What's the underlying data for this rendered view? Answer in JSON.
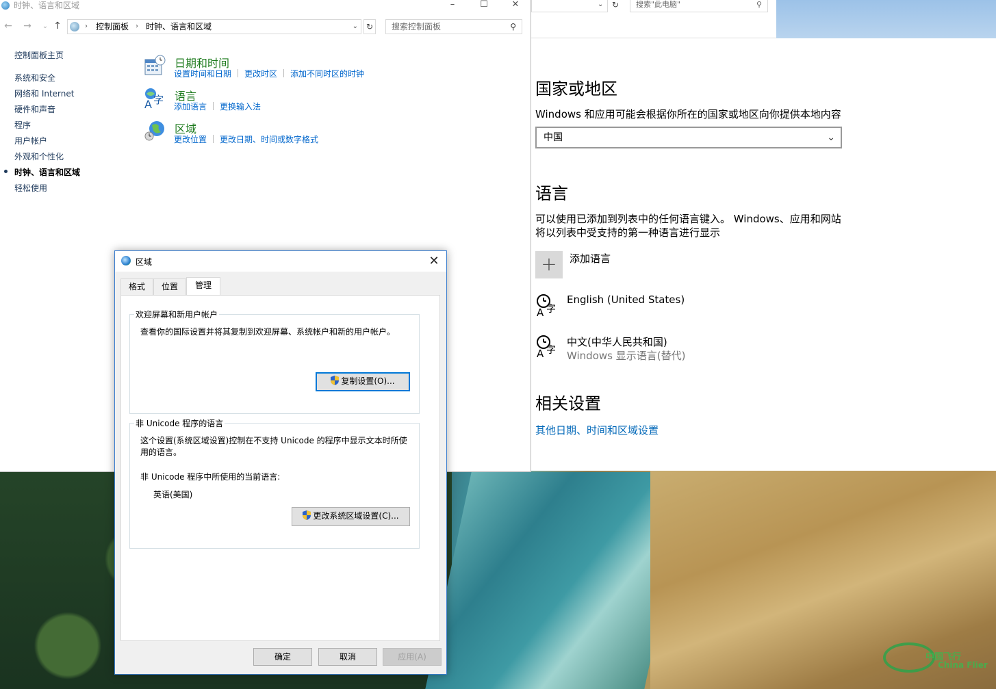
{
  "control_panel": {
    "window_title": "时钟、语言和区域",
    "address_crumbs": [
      "控制面板",
      "时钟、语言和区域"
    ],
    "search_placeholder": "搜索控制面板",
    "sidenav": [
      {
        "label": "控制面板主页",
        "active": false
      },
      {
        "label": "系统和安全",
        "active": false
      },
      {
        "label": "网络和 Internet",
        "active": false
      },
      {
        "label": "硬件和声音",
        "active": false
      },
      {
        "label": "程序",
        "active": false
      },
      {
        "label": "用户帐户",
        "active": false
      },
      {
        "label": "外观和个性化",
        "active": false
      },
      {
        "label": "时钟、语言和区域",
        "active": true
      },
      {
        "label": "轻松使用",
        "active": false
      }
    ],
    "categories": [
      {
        "icon": "calendar-clock-icon",
        "title": "日期和时间",
        "links": [
          "设置时间和日期",
          "更改时区",
          "添加不同时区的时钟"
        ]
      },
      {
        "icon": "language-icon",
        "title": "语言",
        "links": [
          "添加语言",
          "更换输入法"
        ]
      },
      {
        "icon": "globe-icon",
        "title": "区域",
        "links": [
          "更改位置",
          "更改日期、时间或数字格式"
        ]
      }
    ]
  },
  "explorer_strip": {
    "search_placeholder": "搜索\"此电脑\""
  },
  "settings": {
    "country_heading": "国家或地区",
    "country_desc": "Windows 和应用可能会根据你所在的国家或地区向你提供本地内容",
    "country_value": "中国",
    "language_heading": "语言",
    "language_desc": "可以使用已添加到列表中的任何语言键入。 Windows、应用和网站将以列表中受支持的第一种语言进行显示",
    "add_language_label": "添加语言",
    "languages": [
      {
        "name": "English (United States)",
        "sub": ""
      },
      {
        "name": "中文(中华人民共和国)",
        "sub": "Windows 显示语言(替代)"
      }
    ],
    "related_heading": "相关设置",
    "related_link": "其他日期、时间和区域设置"
  },
  "dialog": {
    "title": "区域",
    "tabs": [
      {
        "label": "格式",
        "selected": false
      },
      {
        "label": "位置",
        "selected": false
      },
      {
        "label": "管理",
        "selected": true
      }
    ],
    "welcome_group": {
      "title": "欢迎屏幕和新用户帐户",
      "text": "查看你的国际设置并将其复制到欢迎屏幕、系统帐户和新的用户帐户。",
      "button": "复制设置(O)..."
    },
    "unicode_group": {
      "title": "非 Unicode 程序的语言",
      "text": "这个设置(系统区域设置)控制在不支持 Unicode 的程序中显示文本时所使用的语言。",
      "current_label": "非 Unicode 程序中所使用的当前语言:",
      "current_value": "英语(美国)",
      "button": "更改系统区域设置(C)..."
    },
    "buttons": {
      "ok": "确定",
      "cancel": "取消",
      "apply": "应用(A)"
    }
  },
  "colors": {
    "link_blue": "#0066cc",
    "category_green": "#1e7b1e",
    "settings_link": "#0067b8",
    "focus_blue": "#0078d7"
  }
}
